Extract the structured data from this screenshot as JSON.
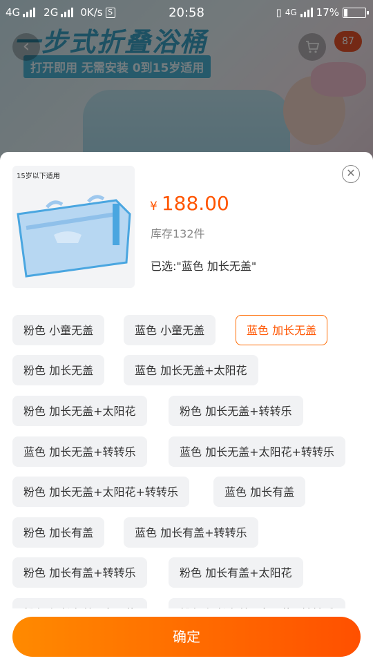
{
  "status_bar": {
    "network_1": "4G",
    "network_2": "2G",
    "speed": "0K/s",
    "speed_icon": "S",
    "time": "20:58",
    "network_3": "4G",
    "battery": "17%"
  },
  "background": {
    "banner_title": "一步式折叠浴桶",
    "banner_subtitle": "打开即用 无需安装 0到15岁适用",
    "cart_badge": "87"
  },
  "product": {
    "thumb_caption": "15岁以下适用",
    "currency": "¥",
    "price": "188.00",
    "stock": "库存132件",
    "selected_label": "已选:\"蓝色 加长无盖\""
  },
  "options": [
    {
      "label": "粉色 小童无盖",
      "selected": false
    },
    {
      "label": "蓝色 小童无盖",
      "selected": false
    },
    {
      "label": "蓝色 加长无盖",
      "selected": true
    },
    {
      "label": "粉色 加长无盖",
      "selected": false
    },
    {
      "label": "蓝色 加长无盖+太阳花",
      "selected": false
    },
    {
      "label": "粉色 加长无盖+太阳花",
      "selected": false
    },
    {
      "label": "粉色 加长无盖+转转乐",
      "selected": false
    },
    {
      "label": "蓝色 加长无盖+转转乐",
      "selected": false
    },
    {
      "label": "蓝色 加长无盖+太阳花+转转乐",
      "selected": false
    },
    {
      "label": "粉色 加长无盖+太阳花+转转乐",
      "selected": false
    },
    {
      "label": "蓝色 加长有盖",
      "selected": false
    },
    {
      "label": "粉色 加长有盖",
      "selected": false
    },
    {
      "label": "蓝色 加长有盖+转转乐",
      "selected": false
    },
    {
      "label": "粉色 加长有盖+转转乐",
      "selected": false
    },
    {
      "label": "粉色 加长有盖+太阳花",
      "selected": false
    },
    {
      "label": "粉色 加长有盖+太阳花",
      "selected": false
    },
    {
      "label": "粉色 加长有盖+太阳花+转转乐",
      "selected": false
    }
  ],
  "confirm_label": "确定",
  "colors": {
    "accent": "#ff5500",
    "button_start": "#ff8a00",
    "button_end": "#ff5000",
    "option_bg": "#f1f2f4"
  },
  "icons": {
    "back": "back-arrow-icon",
    "cart": "cart-icon",
    "close": "close-icon"
  }
}
